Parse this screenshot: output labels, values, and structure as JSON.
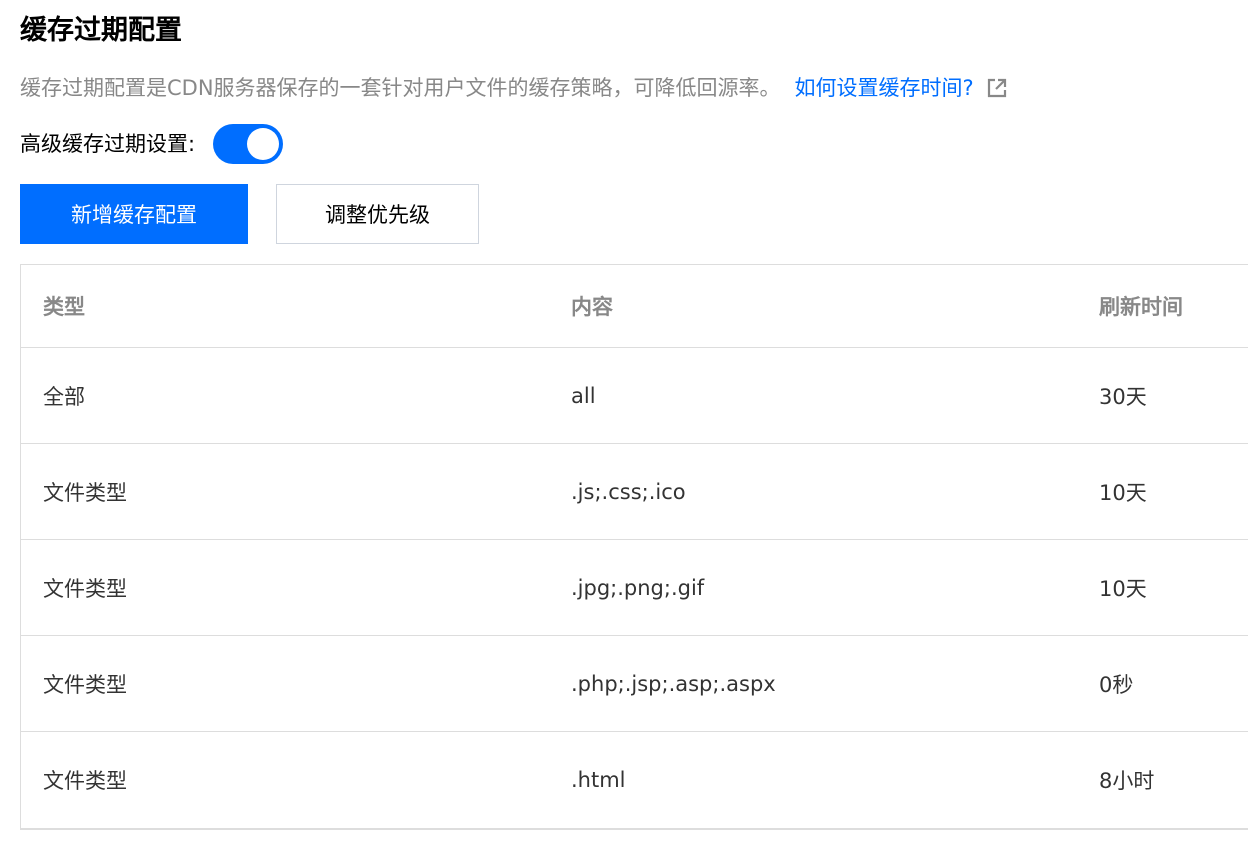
{
  "page": {
    "title": "缓存过期配置",
    "description": "缓存过期配置是CDN服务器保存的一套针对用户文件的缓存策略，可降低回源率。",
    "help_link": "如何设置缓存时间?",
    "external_icon": "external-link-icon"
  },
  "advanced": {
    "label": "高级缓存过期设置:",
    "enabled": true
  },
  "toolbar": {
    "add_label": "新增缓存配置",
    "priority_label": "调整优先级"
  },
  "table": {
    "headers": [
      "类型",
      "内容",
      "刷新时间"
    ],
    "rows": [
      [
        "全部",
        "all",
        "30天"
      ],
      [
        "文件类型",
        ".js;.css;.ico",
        "10天"
      ],
      [
        "文件类型",
        ".jpg;.png;.gif",
        "10天"
      ],
      [
        "文件类型",
        ".php;.jsp;.asp;.aspx",
        "0秒"
      ],
      [
        "文件类型",
        ".html",
        "8小时"
      ]
    ]
  },
  "colors": {
    "accent": "#006eff",
    "muted_text": "#888888",
    "border": "#dddddd"
  }
}
